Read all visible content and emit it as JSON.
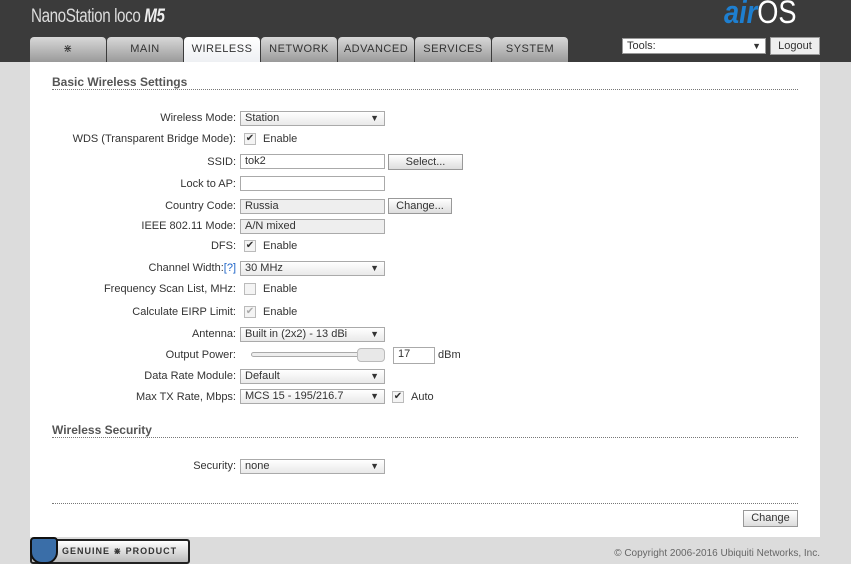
{
  "header": {
    "product": "NanoStation loco",
    "model": "M5",
    "brand_air": "air",
    "brand_os": "OS"
  },
  "tabs": [
    "MAIN",
    "WIRELESS",
    "NETWORK",
    "ADVANCED",
    "SERVICES",
    "SYSTEM"
  ],
  "tools": {
    "label": "Tools:",
    "logout": "Logout"
  },
  "basic": {
    "title": "Basic Wireless Settings",
    "wireless_mode": {
      "label": "Wireless Mode:",
      "value": "Station"
    },
    "wds": {
      "label": "WDS (Transparent Bridge Mode):",
      "text": "Enable",
      "checked": true
    },
    "ssid": {
      "label": "SSID:",
      "value": "tok2",
      "button": "Select..."
    },
    "lock": {
      "label": "Lock to AP:",
      "value": ""
    },
    "country": {
      "label": "Country Code:",
      "value": "Russia",
      "button": "Change..."
    },
    "ieee": {
      "label": "IEEE 802.11 Mode:",
      "value": "A/N mixed"
    },
    "dfs": {
      "label": "DFS:",
      "text": "Enable",
      "checked": true
    },
    "channel": {
      "label": "Channel Width:",
      "help": "[?]",
      "value": "30 MHz"
    },
    "freq": {
      "label": "Frequency Scan List, MHz:",
      "text": "Enable",
      "checked": false
    },
    "eirp": {
      "label": "Calculate EIRP Limit:",
      "text": "Enable",
      "checked": true
    },
    "antenna": {
      "label": "Antenna:",
      "value": "Built in (2x2) - 13 dBi"
    },
    "power": {
      "label": "Output Power:",
      "value": "17",
      "unit": "dBm",
      "slider_fraction": 1.0
    },
    "rate_module": {
      "label": "Data Rate Module:",
      "value": "Default"
    },
    "max_tx": {
      "label": "Max TX Rate, Mbps:",
      "value": "MCS 15 - 195/216.7",
      "auto": "Auto",
      "auto_checked": true
    }
  },
  "security": {
    "title": "Wireless Security",
    "label": "Security:",
    "value": "none"
  },
  "change": "Change",
  "footer": {
    "copyright": "© Copyright 2006-2016 Ubiquiti Networks, Inc.",
    "genuine": "GENUINE",
    "product": "PRODUCT"
  }
}
